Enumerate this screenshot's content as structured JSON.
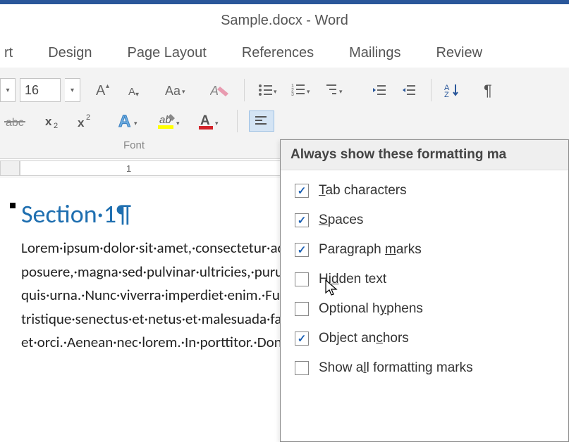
{
  "title": "Sample.docx - Word",
  "tabs": {
    "t0": "rt",
    "t1": "Design",
    "t2": "Page Layout",
    "t3": "References",
    "t4": "Mailings",
    "t5": "Review"
  },
  "ribbon": {
    "fontsize": "16",
    "group_label": "Font"
  },
  "ruler": {
    "n1": "1"
  },
  "doc": {
    "heading": "Section·1¶",
    "body": "Lorem·ipsum·dolor·sit·amet,·consectetur·adipiscing·elit.·Integer· posuere,·magna·sed·pulvinar·ultricies,·purus·lectus·malesuada·libero quis·urna.·Nunc·viverra·imperdiet·enim.·Fusce·est.·Vivamus·a·tellus. tristique·senectus·et·netus·et·malesuada·fames·ac·turpis·egestas. et·orci.·Aenean·nec·lorem.·In·porttitor.·Donec·laoreet·nonummy."
  },
  "options": {
    "header": "Always show these formatting ma",
    "items": [
      {
        "label_pre": "",
        "u": "T",
        "label_post": "ab characters",
        "checked": true
      },
      {
        "label_pre": "",
        "u": "S",
        "label_post": "paces",
        "checked": true
      },
      {
        "label_pre": "Paragraph ",
        "u": "m",
        "label_post": "arks",
        "checked": true
      },
      {
        "label_pre": "Hi",
        "u": "d",
        "label_post": "den text",
        "checked": false
      },
      {
        "label_pre": "Optional h",
        "u": "y",
        "label_post": "phens",
        "checked": false
      },
      {
        "label_pre": "Object an",
        "u": "c",
        "label_post": "hors",
        "checked": true
      },
      {
        "label_pre": "Show a",
        "u": "l",
        "label_post": "l formatting marks",
        "checked": false
      }
    ]
  }
}
